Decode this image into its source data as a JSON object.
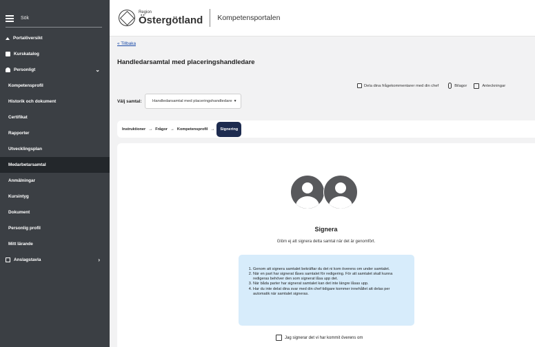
{
  "sidebar": {
    "search_label": "Sök",
    "items": [
      {
        "label": "Portalöversikt",
        "icon": "home-icon"
      },
      {
        "label": "Kurskatalog",
        "icon": "book-icon"
      },
      {
        "label": "Personligt",
        "icon": "user-icon"
      },
      {
        "label": "Kompetensprofil"
      },
      {
        "label": "Historik och dokument"
      },
      {
        "label": "Certifikat"
      },
      {
        "label": "Rapporter"
      },
      {
        "label": "Utvecklingsplan"
      },
      {
        "label": "Medarbetarsamtal"
      },
      {
        "label": "Anmälningar"
      },
      {
        "label": "Kursintyg"
      },
      {
        "label": "Dokument"
      },
      {
        "label": "Personlig profil"
      },
      {
        "label": "Mitt lärande"
      },
      {
        "label": "Anslagstavla",
        "icon": "board-icon"
      }
    ]
  },
  "header": {
    "logo_small": "Region",
    "logo_big": "Östergötland",
    "portal_name": "Kompetensportalen"
  },
  "main": {
    "back_link": "« Tillbaka",
    "title": "Handledarsamtal med placeringshandledare",
    "share_label": "Dela dina frågekommentarer med din chef",
    "attachments_label": "Bilagor",
    "notes_label": "Anteckningar",
    "select_label": "Välj samtal:",
    "select_value": "Handledarsamtal med placeringshandledare",
    "steps": [
      "Instruktioner",
      "Frågor",
      "Kompetensprofil",
      "Signering"
    ]
  },
  "signing": {
    "title": "Signera",
    "subtitle": "Glöm ej att signera detta samtal när det är genomfört.",
    "info_items": [
      "Genom att signera samtalet bekräftar du det ni kom överens om under samtalet.",
      "När en part har signerat låses samtalet för redigering. För att samtalet skall kunna redigeras behöver den som signerat låsa upp det.",
      "När båda parter har signerat samtalet kan det inte längre låsas upp.",
      "Har du inte delat dina svar med din chef tidigare kommer innehållet att delas per automatik när samtalet signeras."
    ],
    "agree_label": "Jag signerar det vi har kommit överens om"
  },
  "colors": {
    "sidebar_bg": "#3b3f44",
    "sidebar_active": "#23272b",
    "step_current": "#1d2b4f",
    "info_bg": "#d7ecfb",
    "link": "#1a4aa8"
  }
}
